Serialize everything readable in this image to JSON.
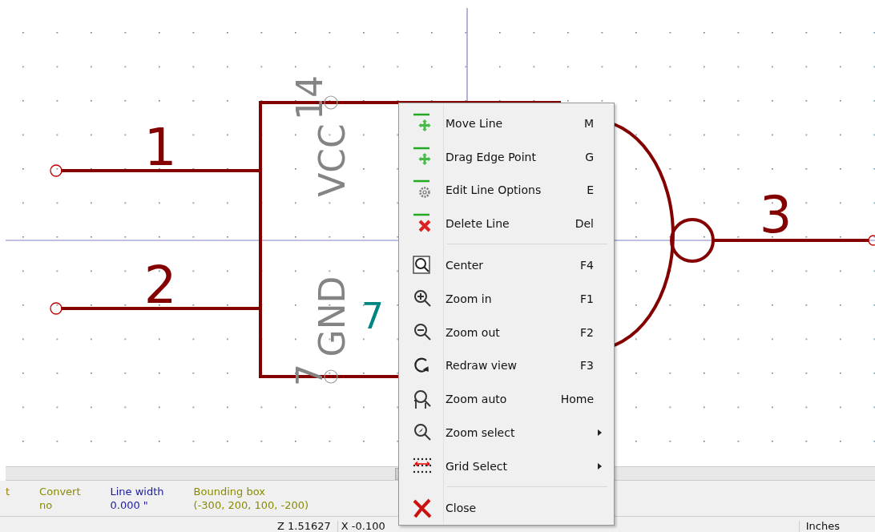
{
  "schematic": {
    "input_pin_1": "1",
    "input_pin_2": "2",
    "output_pin": "3",
    "vcc_label": "VCC",
    "vcc_pin": "14",
    "gnd_label": "GND",
    "gnd_pin": "7",
    "unit_number": "7"
  },
  "context_menu": {
    "sections": [
      [
        {
          "label": "Move Line",
          "shortcut": "M",
          "submenu": false
        },
        {
          "label": "Drag Edge Point",
          "shortcut": "G",
          "submenu": false
        },
        {
          "label": "Edit Line Options",
          "shortcut": "E",
          "submenu": false
        },
        {
          "label": "Delete Line",
          "shortcut": "Del",
          "submenu": false
        }
      ],
      [
        {
          "label": "Center",
          "shortcut": "F4",
          "submenu": false
        },
        {
          "label": "Zoom in",
          "shortcut": "F1",
          "submenu": false
        },
        {
          "label": "Zoom out",
          "shortcut": "F2",
          "submenu": false
        },
        {
          "label": "Redraw view",
          "shortcut": "F3",
          "submenu": false
        },
        {
          "label": "Zoom auto",
          "shortcut": "Home",
          "submenu": false
        },
        {
          "label": "Zoom select",
          "submenu": true
        },
        {
          "label": "Grid Select",
          "submenu": true
        }
      ],
      [
        {
          "label": "Close",
          "submenu": false
        }
      ]
    ]
  },
  "message_panel": [
    {
      "label": "t",
      "color": "#a08000"
    },
    {
      "label": "Convert",
      "value": "no",
      "color": "#8a8a00"
    },
    {
      "label": "Line width",
      "value": "0.000 \"",
      "color": "#1a1aa0"
    },
    {
      "label": "Bounding box",
      "value": "(-300, 200, 100, -200)",
      "color": "#8a8a00"
    }
  ],
  "status_bar": [
    "Z 1.51627",
    "X -0.100",
    "Inches"
  ]
}
